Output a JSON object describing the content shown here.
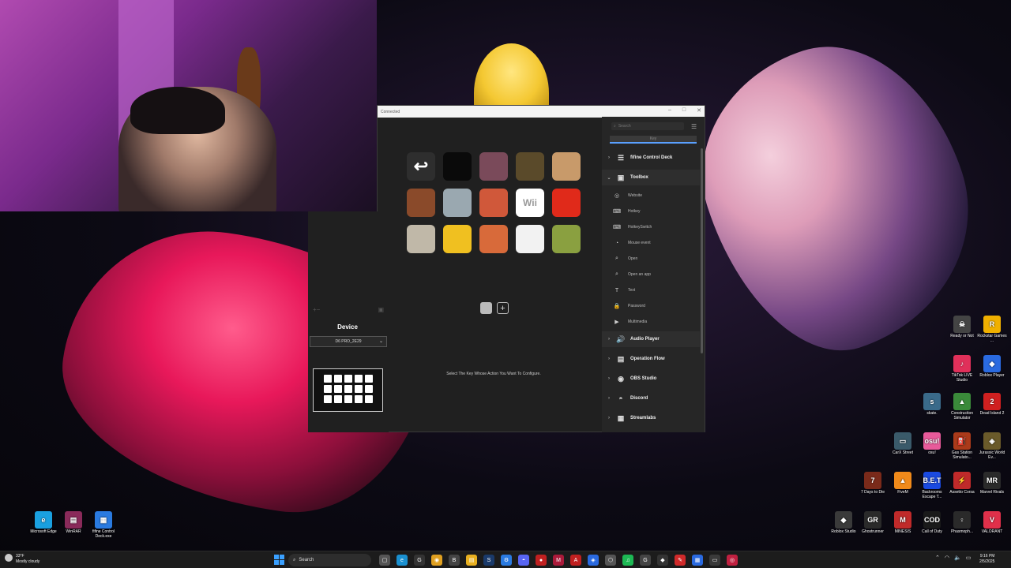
{
  "window": {
    "title": "Connected"
  },
  "device_panel": {
    "title": "Device",
    "selected_device": "D6 PRO_2E29",
    "add_symbol": "+",
    "remove_symbol": "−"
  },
  "main": {
    "hint": "Select The Key Whose Action You Want To Configure.",
    "add_page_symbol": "+",
    "keys": [
      {
        "name": "back",
        "symbol": "↩",
        "bg": "#2e2e2e",
        "color": "#ffffff"
      },
      {
        "name": "dark-image",
        "symbol": "",
        "bg": "#0a0a0a",
        "color": "#ffffff"
      },
      {
        "name": "anime-girl",
        "symbol": "",
        "bg": "#7a4a5a",
        "color": "#ffffff"
      },
      {
        "name": "car-scene",
        "symbol": "",
        "bg": "#5a4a2a",
        "color": "#ffffff"
      },
      {
        "name": "cartoon-hand",
        "symbol": "",
        "bg": "#c89a6a",
        "color": "#ffffff"
      },
      {
        "name": "pixel-art",
        "symbol": "",
        "bg": "#8a4a2a",
        "color": "#ffffff"
      },
      {
        "name": "sketch",
        "symbol": "",
        "bg": "#9aa8b0",
        "color": "#ffffff"
      },
      {
        "name": "meme",
        "symbol": "",
        "bg": "#d0583a",
        "color": "#ffffff"
      },
      {
        "name": "wii",
        "symbol": "Wii",
        "bg": "#ffffff",
        "color": "#999999"
      },
      {
        "name": "angry-face",
        "symbol": "",
        "bg": "#e02a1a",
        "color": "#ffffff"
      },
      {
        "name": "dog",
        "symbol": "",
        "bg": "#c0b8a8",
        "color": "#ffffff"
      },
      {
        "name": "yellow-face",
        "symbol": "",
        "bg": "#f0c020",
        "color": "#ffffff"
      },
      {
        "name": "anime-pirate",
        "symbol": "",
        "bg": "#d86a3a",
        "color": "#ffffff"
      },
      {
        "name": "manga",
        "symbol": "",
        "bg": "#f2f2f2",
        "color": "#ffffff"
      },
      {
        "name": "warrior",
        "symbol": "",
        "bg": "#8aa040",
        "color": "#ffffff"
      }
    ]
  },
  "right_panel": {
    "search_placeholder": "Search",
    "tab_label": "Key",
    "categories": [
      {
        "label": "fifine Control Deck",
        "arrow": "›",
        "icon": "☰"
      },
      {
        "label": "Toolbox",
        "arrow": "⌄",
        "icon": "▣"
      },
      {
        "label": "Audio Player",
        "arrow": "›",
        "icon": "🔊"
      },
      {
        "label": "Operation Flow",
        "arrow": "›",
        "icon": "▤"
      },
      {
        "label": "OBS Studio",
        "arrow": "›",
        "icon": "◉"
      },
      {
        "label": "Discord",
        "arrow": "›",
        "icon": "◓"
      },
      {
        "label": "Streamlabs",
        "arrow": "›",
        "icon": "▦"
      }
    ],
    "toolbox_items": [
      {
        "label": "Website",
        "icon": "◎"
      },
      {
        "label": "Hotkey",
        "icon": "⌨"
      },
      {
        "label": "HotkeySwitch",
        "icon": "⌨"
      },
      {
        "label": "Mouse event",
        "icon": "◔"
      },
      {
        "label": "Open",
        "icon": "⌕"
      },
      {
        "label": "Open an app",
        "icon": "⌕"
      },
      {
        "label": "Text",
        "icon": "T"
      },
      {
        "label": "Password",
        "icon": "🔒"
      },
      {
        "label": "Multimedia",
        "icon": "▶"
      }
    ]
  },
  "desktop_icons": [
    {
      "label": "Microsoft Edge",
      "bg": "#1aa0e0",
      "glyph": "e"
    },
    {
      "label": "WinRAR",
      "bg": "#8a2a5a",
      "glyph": "▤"
    },
    {
      "label": "fifine Control Deck.exe",
      "bg": "#2a7ae0",
      "glyph": "▦"
    },
    {
      "label": "Ready or Not",
      "bg": "#444444",
      "glyph": "☠"
    },
    {
      "label": "Rockstar Games ...",
      "bg": "#f0b000",
      "glyph": "R"
    },
    {
      "label": "TikTok LIVE Studio",
      "bg": "#e0305a",
      "glyph": "♪"
    },
    {
      "label": "Roblox Player",
      "bg": "#2a6ae0",
      "glyph": "◆"
    },
    {
      "label": "skate.",
      "bg": "#3a6a8a",
      "glyph": "s"
    },
    {
      "label": "Construction Simulator",
      "bg": "#3a8a3a",
      "glyph": "▲"
    },
    {
      "label": "Dead Island 2",
      "bg": "#d02020",
      "glyph": "2"
    },
    {
      "label": "CarX Street",
      "bg": "#3a5a6a",
      "glyph": "▭"
    },
    {
      "label": "osu!",
      "bg": "#e85a9a",
      "glyph": "osu!"
    },
    {
      "label": "Gas Station Simulato...",
      "bg": "#aa3a1a",
      "glyph": "⛽"
    },
    {
      "label": "Jurassic World Ev...",
      "bg": "#6a5a2a",
      "glyph": "◈"
    },
    {
      "label": "7 Days to Die",
      "bg": "#7a2a1a",
      "glyph": "7"
    },
    {
      "label": "FiveM",
      "bg": "#f08a1a",
      "glyph": "▲"
    },
    {
      "label": "Backrooms Escape T...",
      "bg": "#1a4ae0",
      "glyph": "B.E.T"
    },
    {
      "label": "Assetto Corsa",
      "bg": "#c02a2a",
      "glyph": "⚡"
    },
    {
      "label": "Marvel Rivals",
      "bg": "#2a2a2a",
      "glyph": "MR"
    },
    {
      "label": "Roblox Studio",
      "bg": "#3a3a3a",
      "glyph": "◆"
    },
    {
      "label": "Ghostrunner",
      "bg": "#2a2a2a",
      "glyph": "GR"
    },
    {
      "label": "MINESIS",
      "bg": "#c02a2a",
      "glyph": "M"
    },
    {
      "label": "Call of Duty",
      "bg": "#1a1a1a",
      "glyph": "COD"
    },
    {
      "label": "Phasmoph...",
      "bg": "#2a2a2a",
      "glyph": "♀"
    },
    {
      "label": "VALORANT",
      "bg": "#e0304a",
      "glyph": "V"
    }
  ],
  "taskbar": {
    "weather_temp": "33°F",
    "weather_desc": "Mostly cloudy",
    "search_label": "Search",
    "time": "9:16 PM",
    "date": "2/5/2025",
    "apps": [
      {
        "name": "file",
        "bg": "#555555",
        "glyph": "▢"
      },
      {
        "name": "edge",
        "bg": "#1a90d0",
        "glyph": "e"
      },
      {
        "name": "github",
        "bg": "#333333",
        "glyph": "G"
      },
      {
        "name": "chrome",
        "bg": "#e0a020",
        "glyph": "◉"
      },
      {
        "name": "brave",
        "bg": "#444444",
        "glyph": "B"
      },
      {
        "name": "explorer",
        "bg": "#e8b020",
        "glyph": "▤"
      },
      {
        "name": "steam",
        "bg": "#1a3a6a",
        "glyph": "S"
      },
      {
        "name": "settings",
        "bg": "#2a7ae0",
        "glyph": "⚙"
      },
      {
        "name": "discord",
        "bg": "#5865f2",
        "glyph": "◓"
      },
      {
        "name": "record",
        "bg": "#c02020",
        "glyph": "●"
      },
      {
        "name": "app-red",
        "bg": "#aa1a3a",
        "glyph": "M"
      },
      {
        "name": "app-amd",
        "bg": "#c02020",
        "glyph": "A"
      },
      {
        "name": "app-blue",
        "bg": "#2a6ae0",
        "glyph": "◈"
      },
      {
        "name": "app-gray",
        "bg": "#555555",
        "glyph": "⬡"
      },
      {
        "name": "spotify",
        "bg": "#1db954",
        "glyph": "♫"
      },
      {
        "name": "app-dark",
        "bg": "#444444",
        "glyph": "G"
      },
      {
        "name": "app-roblox",
        "bg": "#333333",
        "glyph": "◆"
      },
      {
        "name": "app-red2",
        "bg": "#d02a2a",
        "glyph": "✎"
      },
      {
        "name": "app-blue2",
        "bg": "#2a6ae0",
        "glyph": "▦"
      },
      {
        "name": "app-dark2",
        "bg": "#3a3a3a",
        "glyph": "▭"
      },
      {
        "name": "app-ring",
        "bg": "#c02040",
        "glyph": "◎"
      }
    ]
  }
}
